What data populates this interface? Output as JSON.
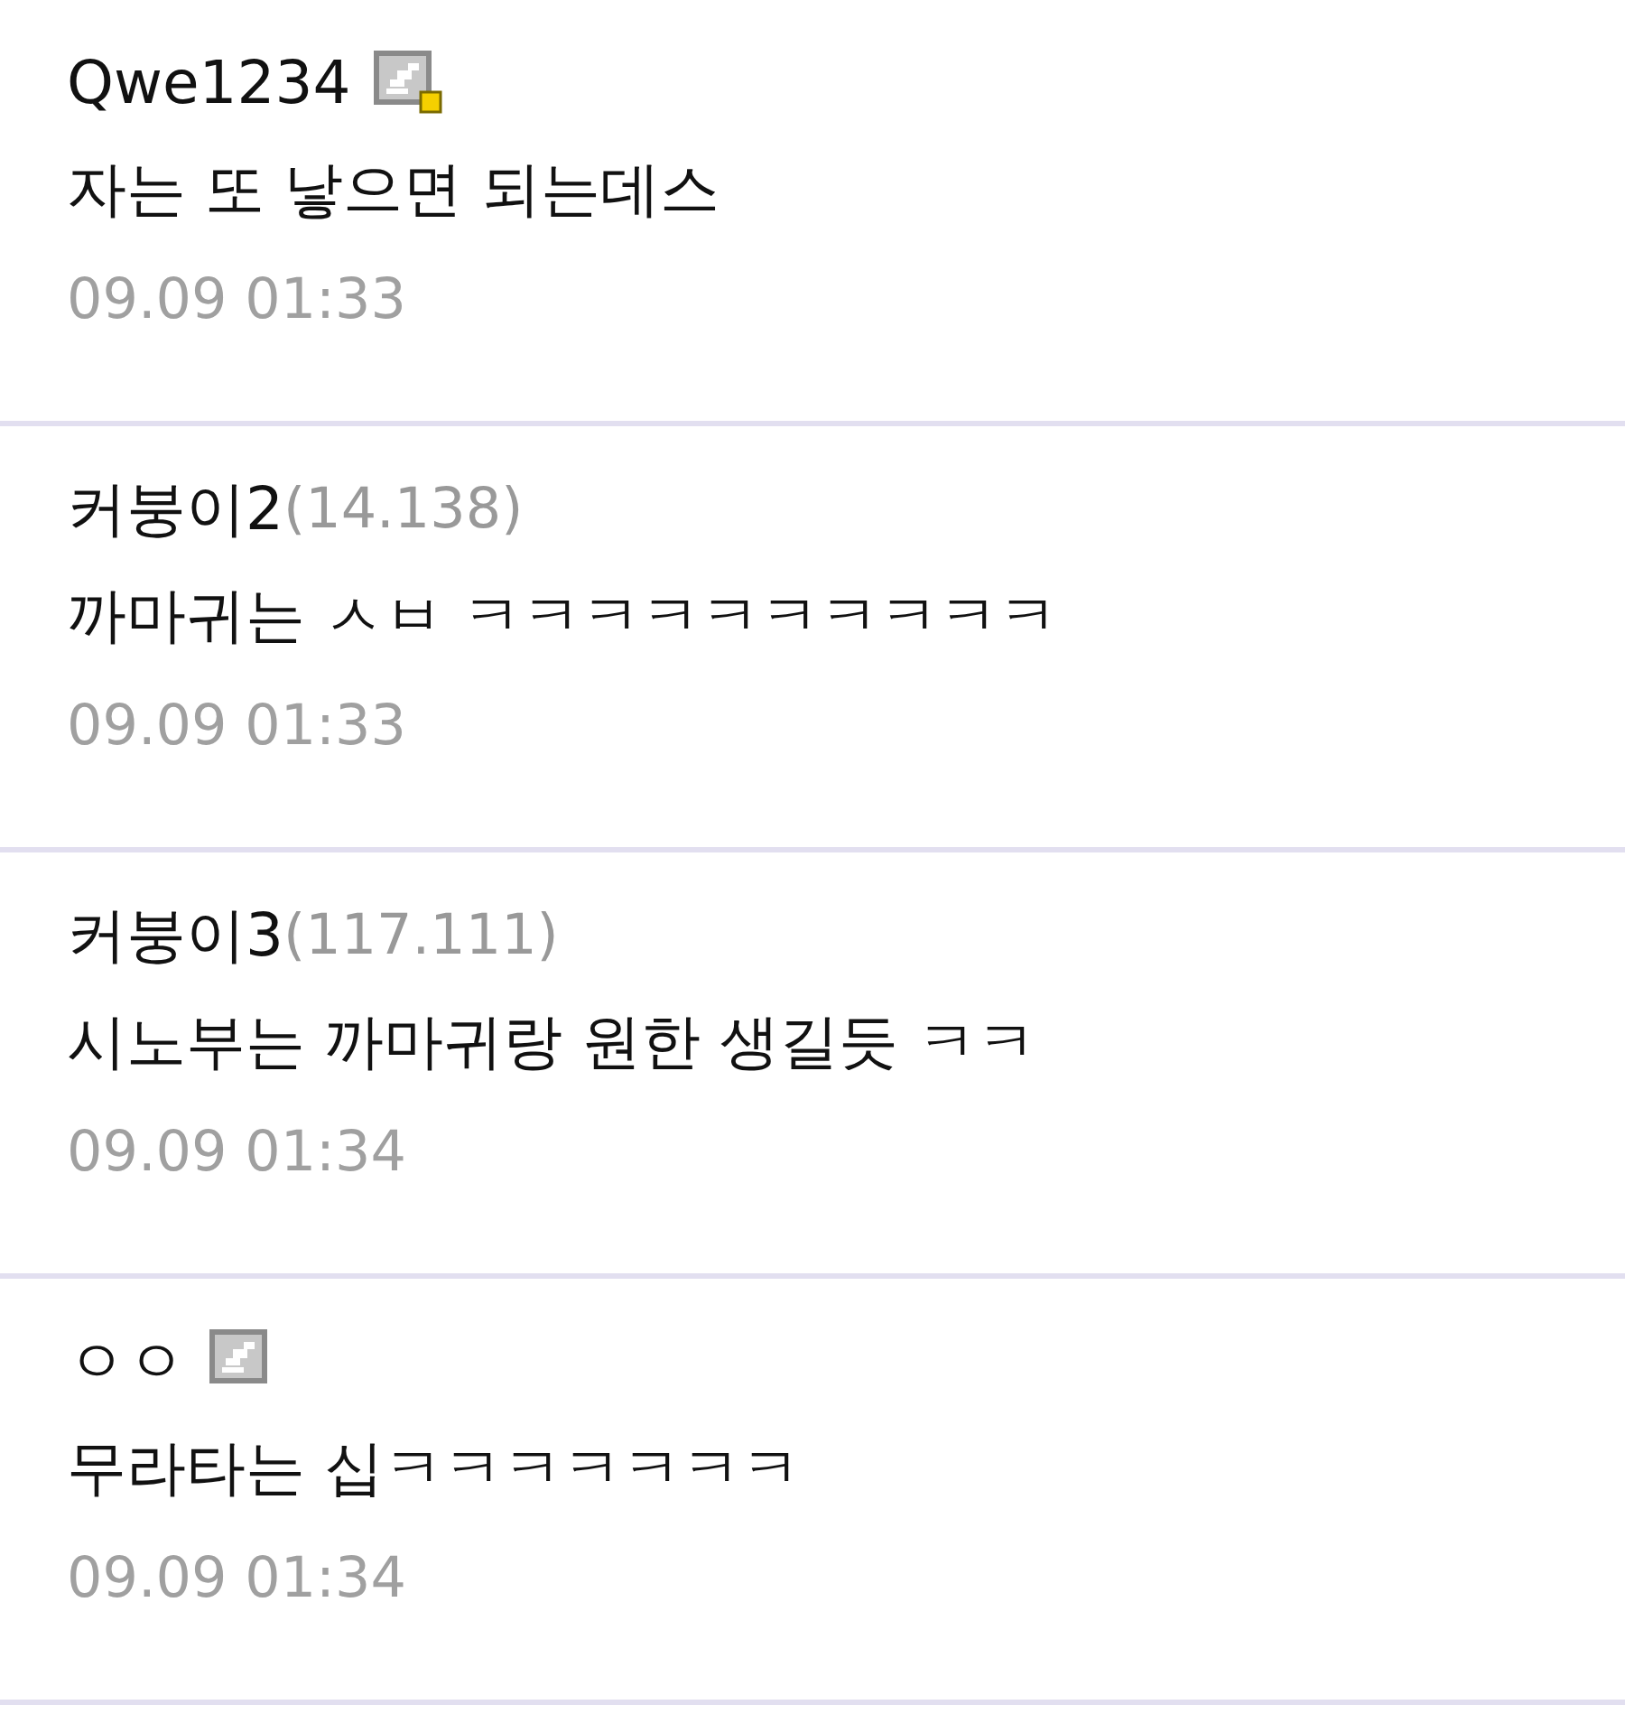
{
  "comments": [
    {
      "author": "Qwe1234",
      "member_icon": {
        "corner_mark": true
      },
      "text": "자는 또 낳으면 되는데스",
      "time": "09.09 01:33"
    },
    {
      "author": "커붕이2",
      "ip": "(14.138)",
      "text": "까마귀는 ㅅㅂ ㅋㅋㅋㅋㅋㅋㅋㅋㅋㅋ",
      "time": "09.09 01:33"
    },
    {
      "author": "커붕이3",
      "ip": "(117.111)",
      "text": "시노부는 까마귀랑 원한 생길듯 ㅋㅋ",
      "time": "09.09 01:34"
    },
    {
      "author": "ㅇㅇ",
      "member_icon": {
        "corner_mark": false
      },
      "text": "무라타는 십ㅋㅋㅋㅋㅋㅋㅋ",
      "time": "09.09 01:34"
    }
  ]
}
